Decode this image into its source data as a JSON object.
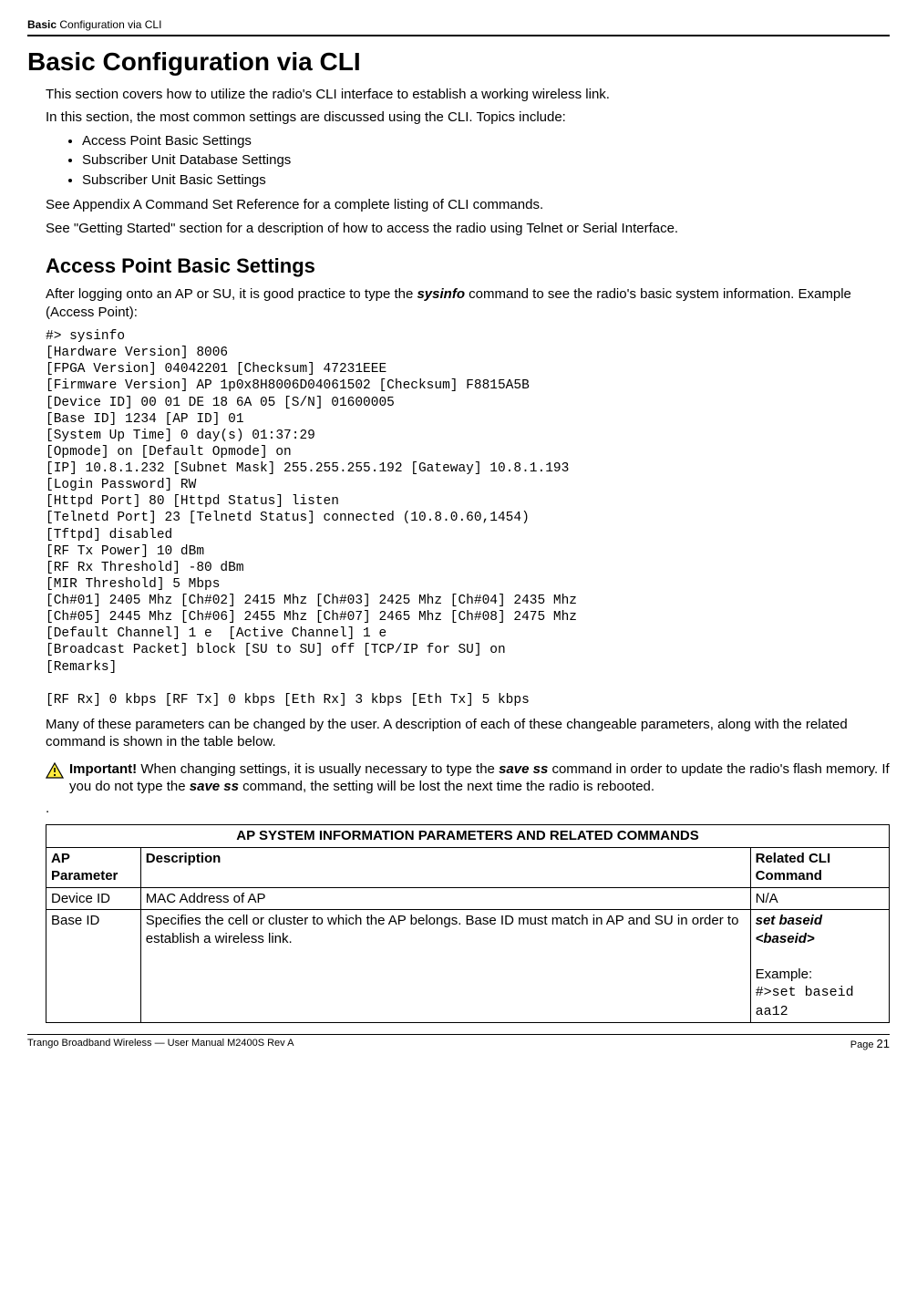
{
  "header": {
    "bold": "Basic",
    "rest": " Configuration via CLI"
  },
  "h1": "Basic Configuration via CLI",
  "intro1": "This section covers how to utilize the radio's CLI interface to establish a working wireless link.",
  "intro2": "In this section, the most common settings are discussed using the CLI.  Topics include:",
  "topics": [
    "Access Point Basic Settings",
    "Subscriber Unit Database Settings",
    "Subscriber Unit Basic Settings"
  ],
  "appendix_line": "See Appendix A Command Set Reference for a complete listing of CLI commands.",
  "getting_started_line": "See \"Getting Started\" section for a description of how to access the radio using Telnet or Serial Interface.",
  "h2": "Access Point Basic Settings",
  "h2_para_pre": "After logging onto an AP or SU, it is good practice to type the ",
  "h2_cmd": "sysinfo",
  "h2_para_post": " command to see the radio's basic system information.  Example (Access Point):",
  "code": "#> sysinfo\n[Hardware Version] 8006\n[FPGA Version] 04042201 [Checksum] 47231EEE\n[Firmware Version] AP 1p0x8H8006D04061502 [Checksum] F8815A5B\n[Device ID] 00 01 DE 18 6A 05 [S/N] 01600005\n[Base ID] 1234 [AP ID] 01\n[System Up Time] 0 day(s) 01:37:29\n[Opmode] on [Default Opmode] on\n[IP] 10.8.1.232 [Subnet Mask] 255.255.255.192 [Gateway] 10.8.1.193\n[Login Password] RW\n[Httpd Port] 80 [Httpd Status] listen\n[Telnetd Port] 23 [Telnetd Status] connected (10.8.0.60,1454)\n[Tftpd] disabled\n[RF Tx Power] 10 dBm\n[RF Rx Threshold] -80 dBm\n[MIR Threshold] 5 Mbps\n[Ch#01] 2405 Mhz [Ch#02] 2415 Mhz [Ch#03] 2425 Mhz [Ch#04] 2435 Mhz\n[Ch#05] 2445 Mhz [Ch#06] 2455 Mhz [Ch#07] 2465 Mhz [Ch#08] 2475 Mhz\n[Default Channel] 1 e  [Active Channel] 1 e\n[Broadcast Packet] block [SU to SU] off [TCP/IP for SU] on\n[Remarks]\n\n[RF Rx] 0 kbps [RF Tx] 0 kbps [Eth Rx] 3 kbps [Eth Tx] 5 kbps",
  "post_code": "Many of these parameters can be changed by the user.  A description of each of these changeable parameters, along with the related command is shown in the table below.",
  "important": {
    "label": "Important!",
    "text_pre": "  When changing settings, it is usually necessary to type the ",
    "cmd1": "save ss",
    "text_mid": " command in order to update the radio's flash memory.  If you do not type the ",
    "cmd2": "save ss",
    "text_post": " command, the setting will be lost the next time the radio is rebooted."
  },
  "table": {
    "title": "AP SYSTEM INFORMATION PARAMETERS AND RELATED COMMANDS",
    "headers": [
      "AP Parameter",
      "Description",
      "Related CLI Command"
    ],
    "rows": [
      {
        "param": "Device ID",
        "desc": "MAC Address of AP",
        "cmd_bold": "",
        "cmd_plain": "N/A",
        "example_label": "",
        "example_code": ""
      },
      {
        "param": "Base ID",
        "desc": "Specifies the cell or cluster to which the AP belongs. Base ID must match in AP and SU in order to establish a wireless link.",
        "cmd_bold": "set baseid <baseid>",
        "cmd_plain": "",
        "example_label": "Example:",
        "example_code": "#>set baseid aa12"
      }
    ]
  },
  "footer": {
    "left": "Trango Broadband Wireless — User Manual M2400S Rev A",
    "page_label": "Page ",
    "page_num": "21"
  }
}
